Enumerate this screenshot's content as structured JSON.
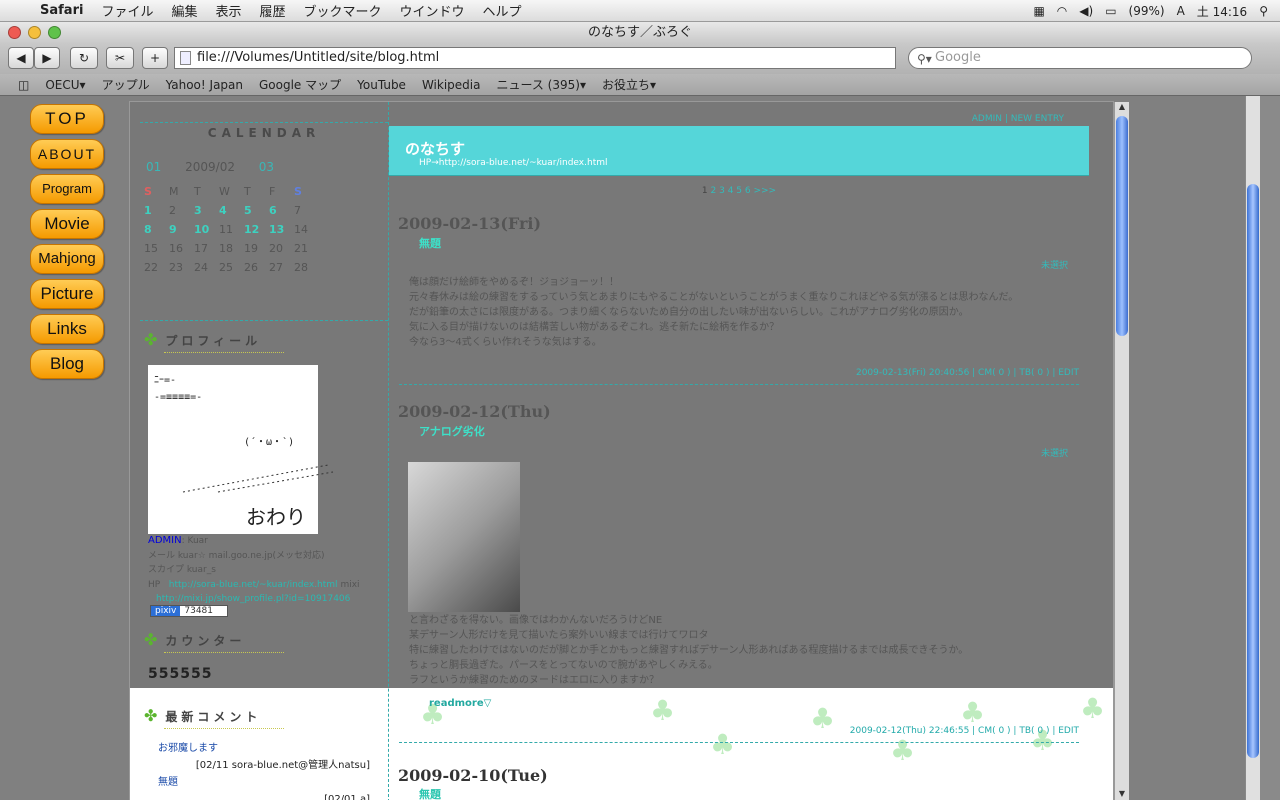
{
  "menubar": {
    "app": "Safari",
    "items": [
      "ファイル",
      "編集",
      "表示",
      "履歴",
      "ブックマーク",
      "ウインドウ",
      "ヘルプ"
    ],
    "battery": "(99%)",
    "clock": "土 14:16"
  },
  "window": {
    "title": "のなちす／ぶろぐ"
  },
  "toolbar": {
    "url": "file:///Volumes/Untitled/site/blog.html",
    "search_placeholder": "Google"
  },
  "bookmarks": [
    "OECU▾",
    "アップル",
    "Yahoo! Japan",
    "Google マップ",
    "YouTube",
    "Wikipedia",
    "ニュース (395)▾",
    "お役立ち▾"
  ],
  "nav": [
    "TOP",
    "ABOUT",
    "Program",
    "Movie",
    "Mahjong",
    "Picture",
    "Links",
    "Blog"
  ],
  "calendar": {
    "title": "CALENDAR",
    "prev": "01",
    "current": "2009/02",
    "next": "03",
    "weekdays": [
      "S",
      "M",
      "T",
      "W",
      "T",
      "F",
      "S"
    ],
    "weeks": [
      [
        "1",
        "2",
        "3",
        "4",
        "5",
        "6",
        "7"
      ],
      [
        "8",
        "9",
        "10",
        "11",
        "12",
        "13",
        "14"
      ],
      [
        "15",
        "16",
        "17",
        "18",
        "19",
        "20",
        "21"
      ],
      [
        "22",
        "23",
        "24",
        "25",
        "26",
        "27",
        "28"
      ]
    ],
    "linked_days": [
      "1",
      "3",
      "4",
      "5",
      "6",
      "8",
      "9",
      "10",
      "12",
      "13"
    ]
  },
  "profile": {
    "title": "プロフィール",
    "image_text": [
      "ﾆｰ=-",
      "-=≡≡≡≡=-",
      "(´・ω・`)"
    ],
    "signature": "おわり",
    "admin_label": "ADMIN",
    "admin_name": ": Kuar",
    "mail": "メール  kuar☆ mail.goo.ne.jp(メッセ対応)",
    "skype": "スカイプ  kuar_s",
    "hp_label": "HP",
    "hp_url": "http://sora-blue.net/~kuar/index.html",
    "mixi_label": "mixi",
    "mixi_url": "http://mixi.jp/show_profile.pl?id=10917406",
    "pixiv_label": "pixiv",
    "pixiv_id": "73481"
  },
  "counter": {
    "title": "カウンター",
    "value": "555555"
  },
  "recent_comments": {
    "title": "最新コメント",
    "items": [
      {
        "title": "お邪魔します",
        "meta": "[02/11 sora-blue.net@管理人natsu]"
      },
      {
        "title": "無題",
        "meta": "[02/01 a]"
      }
    ]
  },
  "blog": {
    "toplinks": "ADMIN | NEW ENTRY",
    "header_title": "のなちす",
    "header_url": "HP→http://sora-blue.net/~kuar/index.html",
    "pager_current": "1",
    "pager_rest": "2 3 4 5 6 >>>",
    "entries": [
      {
        "date": "2009-02-13(Fri)",
        "title": "無題",
        "category": "未選択",
        "body": [
          "俺は顔だけ絵師をやめるぞ！ジョジョーッ！！",
          "元々春休みは絵の練習をするっていう気とあまりにもやることがないということがうまく重なりこれほどやる気が漲るとは思わなんだ。",
          "だが鉛筆の太さには限度がある。つまり細くならないため自分の出したい味が出ないらしい。これがアナログ劣化の原因か。",
          "気に入る目が描けないのは結構苦しい物があるぞこれ。逃そ新たに絵柄を作るか？",
          "今なら3～4式くらい作れそうな気はする。"
        ],
        "footer": "2009-02-13(Fri)  20:40:56 | CM( 0 ) | TB( 0 ) | EDIT"
      },
      {
        "date": "2009-02-12(Thu)",
        "title": "アナログ劣化",
        "category": "未選択",
        "body": [
          "と言わざるを得ない。画像ではわかんないだろうけどNE",
          "某デサーン人形だけを見て描いたら案外いい線までは行けてワロタ",
          "特に練習したわけではないのだが脚とか手とかもっと練習すればデサーン人形あればある程度描けるまでは成長できそうか。",
          "ちょっと胴長過ぎた。パースをとってないので腕があやしくみえる。",
          "ラフというか練習のためのヌードはエロに入りますか？"
        ],
        "readmore": "readmore▽",
        "footer": "2009-02-12(Thu)  22:46:55 | CM( 0 ) | TB( 0 ) | EDIT"
      },
      {
        "date": "2009-02-10(Tue)",
        "title": "無題"
      }
    ]
  }
}
